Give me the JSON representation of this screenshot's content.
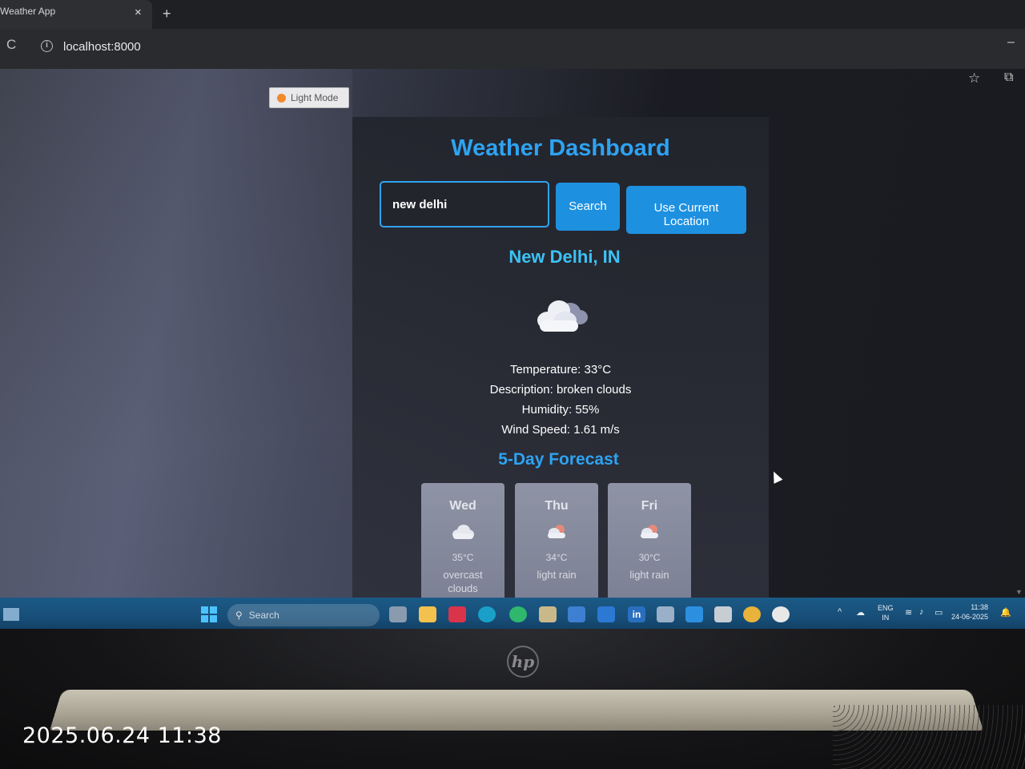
{
  "browser": {
    "tab_title": "Weather App",
    "close_glyph": "×",
    "new_tab_glyph": "+",
    "reload_glyph": "C",
    "url": "localhost:8000",
    "minimize_glyph": "–",
    "bookmark_glyph": "☆",
    "extensions_glyph": "⧉"
  },
  "app": {
    "mode_toggle_label": "Light Mode",
    "title": "Weather Dashboard",
    "search_value": "new delhi",
    "search_button": "Search",
    "location_button_line1": "Use Current",
    "location_button_line2": "Location",
    "city": "New Delhi, IN",
    "current_icon": "cloud-icon",
    "details": {
      "temperature": "Temperature: 33°C",
      "description": "Description: broken clouds",
      "humidity": "Humidity: 55%",
      "wind": "Wind Speed: 1.61 m/s"
    },
    "forecast_title": "5-Day Forecast",
    "forecast": [
      {
        "day": "Wed",
        "temp": "35°C",
        "desc": "overcast clouds",
        "icon": "cloud-icon"
      },
      {
        "day": "Thu",
        "temp": "34°C",
        "desc": "light rain",
        "icon": "sun-cloud-icon"
      },
      {
        "day": "Fri",
        "temp": "30°C",
        "desc": "light rain",
        "icon": "sun-cloud-icon"
      }
    ]
  },
  "taskbar": {
    "search_label": "Search",
    "search_icon_glyph": "⚲",
    "tray_chevron": "^",
    "lang_line1": "ENG",
    "lang_line2": "IN",
    "time": "11:38",
    "date": "24-06-2025"
  },
  "photo": {
    "timestamp": "2025.06.24 11:38",
    "brand_logo": "hp"
  },
  "colors": {
    "accent": "#2ea3f2",
    "city": "#3cc2f5",
    "button": "#1e90e0"
  }
}
